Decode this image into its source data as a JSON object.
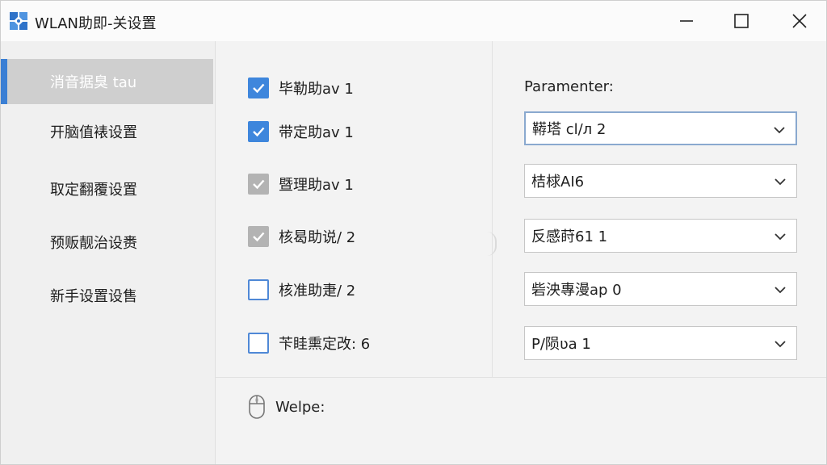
{
  "window": {
    "title": "WLAN助即-关设置",
    "minimize_icon": "minimize-icon",
    "maximize_icon": "maximize-icon",
    "close_icon": "close-icon"
  },
  "sidebar": {
    "items": [
      {
        "label": "消音据臭 tau",
        "active": true
      },
      {
        "label": "开脑值裱设置",
        "active": false
      },
      {
        "label": "取定翻覆设置",
        "active": false
      },
      {
        "label": "预贩靓治设赉",
        "active": false
      },
      {
        "label": "新手设置设售",
        "active": false
      }
    ]
  },
  "options": {
    "items": [
      {
        "label": "毕勒助av 1",
        "state": "checked"
      },
      {
        "label": "带定助av 1",
        "state": "checked"
      },
      {
        "label": "暨理助av 1",
        "state": "checked-disabled"
      },
      {
        "label": "核曷助说/ 2",
        "state": "checked-disabled"
      },
      {
        "label": "核准助疌/ 2",
        "state": "unchecked"
      },
      {
        "label": "苄眭熏定改: 6",
        "state": "unchecked"
      }
    ]
  },
  "parameters": {
    "title": "Paramenter:",
    "selects": [
      {
        "value": "鞯塔 cl/л 2",
        "focused": true
      },
      {
        "value": "桔梂AI6",
        "focused": false
      },
      {
        "value": "反感莳61 1",
        "focused": false
      },
      {
        "value": "砦泱專漫ap 0",
        "focused": false
      },
      {
        "value": "P/陨ʋa 1",
        "focused": false
      }
    ]
  },
  "footer": {
    "label": "Welpe:",
    "icon": "mouse-icon"
  },
  "colors": {
    "accent": "#3b7fd4",
    "checkbox_on": "#3e86dc",
    "checkbox_disabled": "#b3b3b3",
    "sidebar_active_bg": "#cfcfcf"
  }
}
